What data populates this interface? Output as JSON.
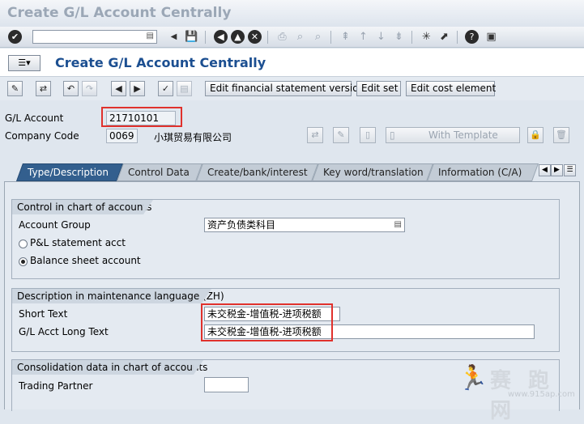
{
  "window": {
    "title": "Create G/L Account Centrally"
  },
  "system_toolbar": {
    "command_field_value": ""
  },
  "app": {
    "title": "Create G/L Account Centrally"
  },
  "app_toolbar": {
    "btn_edit_fsv": "Edit financial statement version",
    "btn_edit_set": "Edit set",
    "btn_edit_cost_element": "Edit cost element"
  },
  "header": {
    "gl_account_label": "G/L Account",
    "gl_account_value": "21710101",
    "company_code_label": "Company Code",
    "company_code_value": "0069",
    "company_name": "小琪贸易有限公司",
    "with_template": "With Template"
  },
  "tabs": [
    {
      "label": "Type/Description",
      "active": true
    },
    {
      "label": "Control Data",
      "active": false
    },
    {
      "label": "Create/bank/interest",
      "active": false
    },
    {
      "label": "Key word/translation",
      "active": false
    },
    {
      "label": "Information (C/A)",
      "active": false
    }
  ],
  "control_group": {
    "title": "Control in chart of accounts",
    "account_group_label": "Account Group",
    "account_group_value": "资产负债类科目",
    "radio_pl_label": "P&L statement acct",
    "radio_bs_label": "Balance sheet account",
    "selected": "Balance sheet account"
  },
  "description_group": {
    "title": "Description in maintenance language (ZH)",
    "short_text_label": "Short Text",
    "short_text_value": "未交税金-增值税-进项税额",
    "long_text_label": "G/L Acct Long Text",
    "long_text_value": "未交税金-增值税-进项税额"
  },
  "consolidation_group": {
    "title": "Consolidation data in chart of accounts",
    "trading_partner_label": "Trading Partner",
    "trading_partner_value": ""
  },
  "watermark": {
    "text": "赛 跑 网",
    "url": "www.915ap.com"
  },
  "colors": {
    "accent": "#335f8e",
    "title_blue": "#1c4f91",
    "highlight": "#e0312c"
  }
}
